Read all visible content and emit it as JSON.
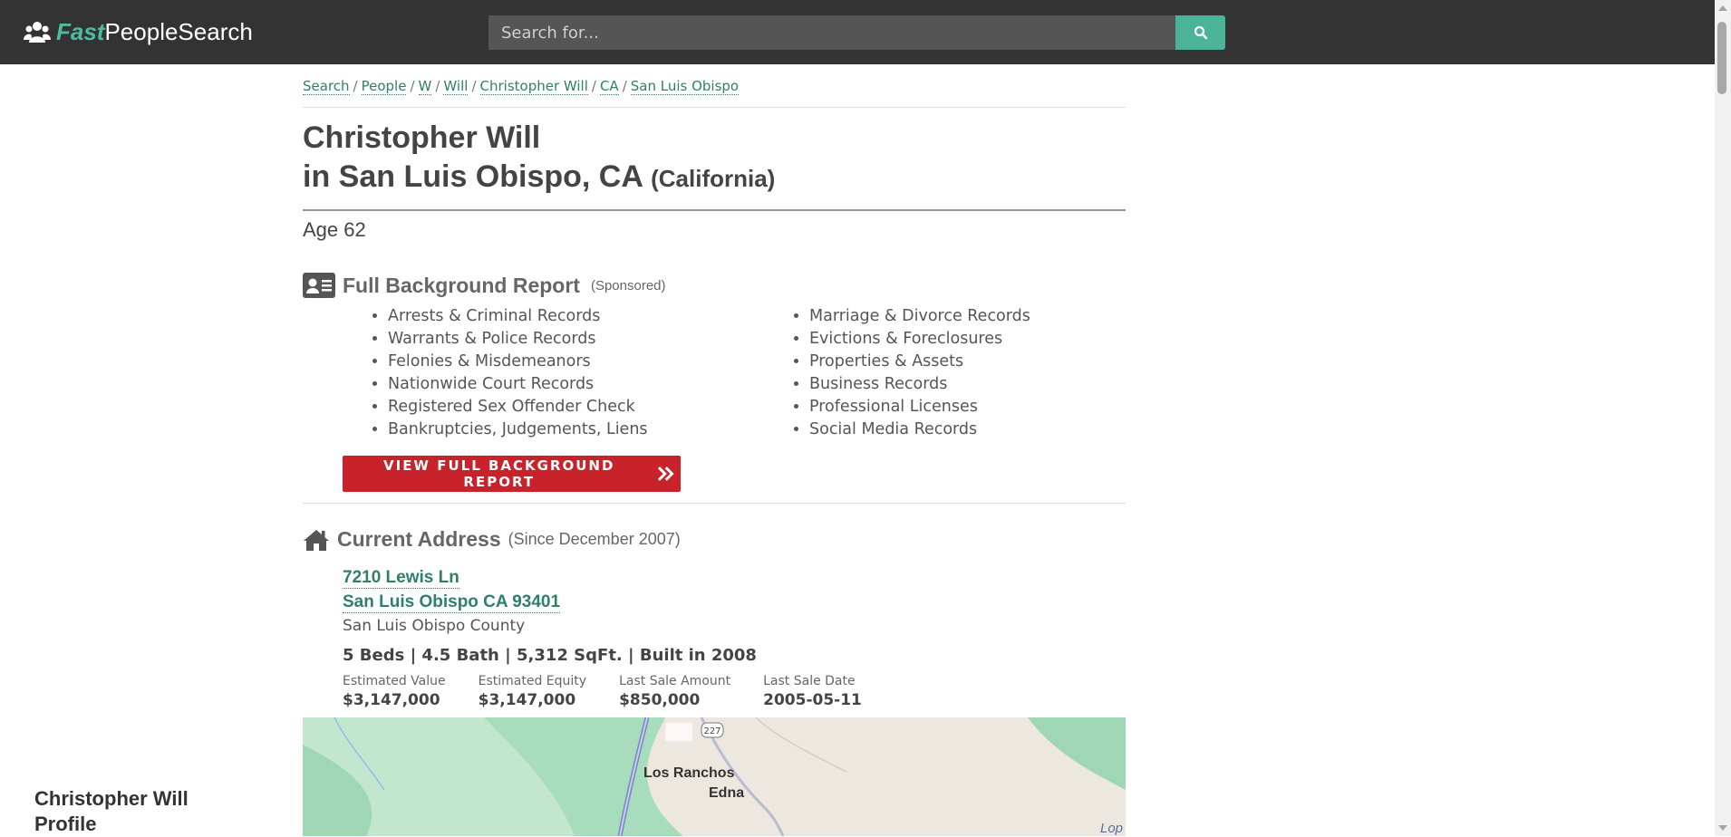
{
  "header": {
    "logo_fast": "Fast",
    "logo_rest": "PeopleSearch",
    "search_placeholder": "Search for...",
    "accent_color": "#4bbc9c"
  },
  "breadcrumb": [
    "Search",
    "People",
    "W",
    "Will",
    "Christopher Will",
    "CA",
    "San Luis Obispo"
  ],
  "title": {
    "name": "Christopher Will",
    "location": "in San Luis Obispo, CA",
    "state": "(California)"
  },
  "age": "Age 62",
  "background_report": {
    "heading": "Full Background Report",
    "sponsored": "(Sponsored)",
    "left_items": [
      "Arrests & Criminal Records",
      "Warrants & Police Records",
      "Felonies & Misdemeanors",
      "Nationwide Court Records",
      "Registered Sex Offender Check",
      "Bankruptcies, Judgements, Liens"
    ],
    "right_items": [
      "Marriage & Divorce Records",
      "Evictions & Foreclosures",
      "Properties & Assets",
      "Business Records",
      "Professional Licenses",
      "Social Media Records"
    ],
    "button_label": "VIEW FULL BACKGROUND REPORT",
    "button_color": "#c8222a"
  },
  "current_address": {
    "heading": "Current Address",
    "since": "(Since December 2007)",
    "line1": "7210 Lewis Ln",
    "line2": "San Luis Obispo CA 93401",
    "county": "San Luis Obispo County",
    "specs": "5 Beds | 4.5 Bath | 5,312 SqFt. | Built in 2008",
    "values": [
      {
        "label": "Estimated Value",
        "value": "$3,147,000"
      },
      {
        "label": "Estimated Equity",
        "value": "$3,147,000"
      },
      {
        "label": "Last Sale Amount",
        "value": "$850,000"
      },
      {
        "label": "Last Sale Date",
        "value": "2005-05-11"
      }
    ]
  },
  "map": {
    "route_label": "227",
    "place1": "Los Ranchos",
    "place2": "Edna",
    "place3": "Lop"
  },
  "sidebar": {
    "profile_title": "Christopher Will Profile"
  }
}
